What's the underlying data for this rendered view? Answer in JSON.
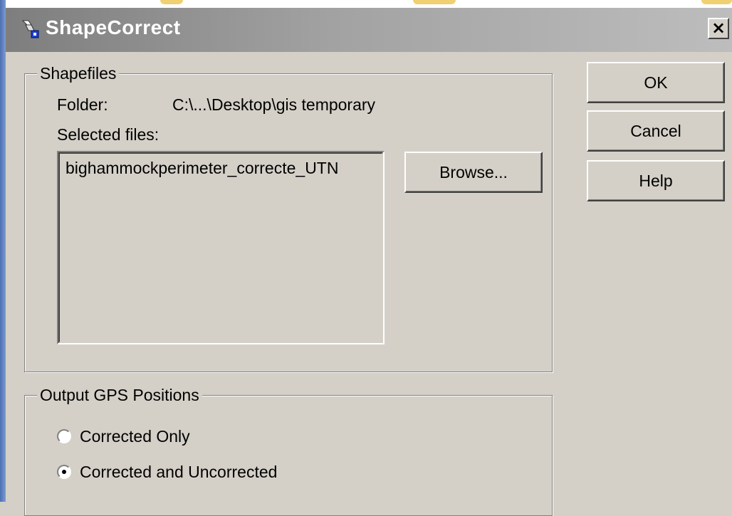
{
  "window": {
    "title": "ShapeCorrect",
    "close_glyph": "×",
    "title_icon": "shapecorrect-app-icon"
  },
  "shapefiles": {
    "legend": "Shapefiles",
    "folder_label": "Folder:",
    "folder_value": "C:\\...\\Desktop\\gis temporary",
    "selected_files_label": "Selected files:",
    "files": [
      "bighammockperimeter_correcte_UTN"
    ],
    "browse_label": "Browse..."
  },
  "buttons": {
    "ok": "OK",
    "cancel": "Cancel",
    "help": "Help"
  },
  "output": {
    "legend": "Output GPS Positions",
    "options": [
      {
        "label": "Corrected Only",
        "selected": false
      },
      {
        "label": "Corrected and Uncorrected",
        "selected": true
      }
    ]
  },
  "colors": {
    "face": "#d4d0c8",
    "title_gradient_start": "#7e7e7e",
    "title_gradient_end": "#bdbdbd"
  }
}
